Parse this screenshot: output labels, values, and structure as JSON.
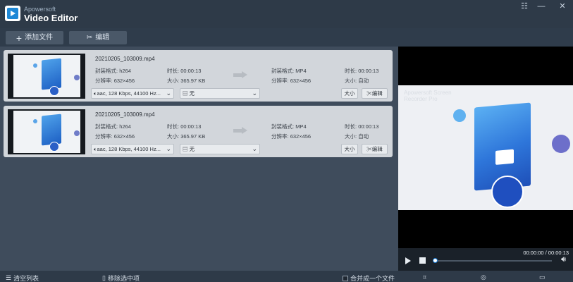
{
  "titlebar": {
    "brand": "Apowersoft",
    "app_name": "Video Editor",
    "icons": [
      "menu-icon",
      "minimize-icon",
      "close-icon"
    ]
  },
  "toolbar": {
    "add_file": "添加文件",
    "edit": "编辑"
  },
  "files": [
    {
      "name": "20210205_103009.mp4",
      "src_format_label": "封装格式:",
      "src_format": "h264",
      "src_duration_label": "时长:",
      "src_duration": "00:00:13",
      "src_resolution_label": "分辨率:",
      "src_resolution": "632×456",
      "src_size_label": "大小:",
      "src_size": "365.97 KB",
      "dst_format_label": "封装格式:",
      "dst_format": "MP4",
      "dst_duration_label": "时长:",
      "dst_duration": "00:00:13",
      "dst_resolution_label": "分辨率:",
      "dst_resolution": "632×456",
      "dst_size_label": "大小:",
      "dst_size": "自动",
      "audio": "aac, 128 Kbps, 44100 Hz...",
      "subtitle": "无",
      "size_button": "大小",
      "edit_button": "编辑"
    },
    {
      "name": "20210205_103009.mp4",
      "src_format_label": "封装格式:",
      "src_format": "h264",
      "src_duration_label": "时长:",
      "src_duration": "00:00:13",
      "src_resolution_label": "分辨率:",
      "src_resolution": "632×456",
      "src_size_label": "大小:",
      "src_size": "365.97 KB",
      "dst_format_label": "封装格式:",
      "dst_format": "MP4",
      "dst_duration_label": "时长:",
      "dst_duration": "00:00:13",
      "dst_resolution_label": "分辨率:",
      "dst_resolution": "632×456",
      "dst_size_label": "大小:",
      "dst_size": "自动",
      "audio": "aac, 128 Kbps, 44100 Hz...",
      "subtitle": "无",
      "size_button": "大小",
      "edit_button": "编辑"
    }
  ],
  "preview": {
    "watermark": "Apowersoft Screen Recorder Pro",
    "time": "00:00:00 / 00:00:13",
    "progress": 0
  },
  "bottombar": {
    "clear_list": "清空列表",
    "remove_selected": "移除选中项",
    "merge": "合并成一个文件"
  }
}
